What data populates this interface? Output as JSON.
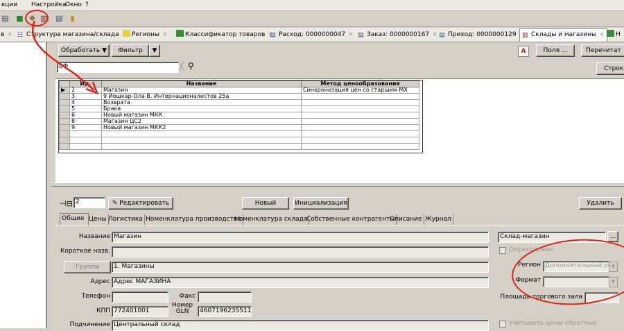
{
  "menu": {
    "items": [
      "кции",
      "Настройка",
      "Окно",
      "?"
    ]
  },
  "doc_tabs": [
    {
      "label": "в",
      "active": false
    },
    {
      "label": "Структура магазина/склада",
      "active": false
    },
    {
      "label": "Регионы",
      "active": false
    },
    {
      "label": "Классификатор товаров",
      "active": false
    },
    {
      "label": "Расход: 0000000047",
      "active": false
    },
    {
      "label": "Заказ: 0000000167",
      "active": false
    },
    {
      "label": "Приход: 0000000129",
      "active": false
    },
    {
      "label": "Склады и магазины",
      "active": true
    },
    {
      "label": "Н",
      "active": false
    }
  ],
  "toolbar_top": {
    "process_label": "Обработать",
    "filter_label": "Фильтр",
    "fields_label": "Поля ...",
    "recalc_label": "Перечитат",
    "rows_label": "Строк",
    "a_badge": "A"
  },
  "search": {
    "value": "оФ"
  },
  "grid": {
    "columns": [
      "Ид.",
      "Название",
      "Метод ценообразования"
    ],
    "rows": [
      {
        "id": "2",
        "name": "Магазин",
        "method": "Синхронизация цен со старшим МХ",
        "current": true
      },
      {
        "id": "3",
        "name": "9 Йошкар-Ола В. Интернационалистов 25а",
        "method": "",
        "current": false
      },
      {
        "id": "4",
        "name": "Возврата",
        "method": "",
        "current": false
      },
      {
        "id": "5",
        "name": "Брака",
        "method": "",
        "current": false
      },
      {
        "id": "6",
        "name": "Новый магазин МКК",
        "method": "",
        "current": false
      },
      {
        "id": "8",
        "name": "Магазин ЦС2",
        "method": "",
        "current": false
      },
      {
        "id": "9",
        "name": "Новый магазин МКК2",
        "method": "",
        "current": false
      }
    ]
  },
  "detail_toolbar": {
    "id_value": "2",
    "edit_label": "Редактировать",
    "new_label": "Новый",
    "init_label": "Инициализация",
    "delete_label": "Удалить"
  },
  "detail_tabs": [
    "Общие",
    "Цены",
    "Логистика",
    "Номенклатура производства",
    "Номенклатура склада",
    "Собственные контрагенты",
    "Описание",
    "Журнал"
  ],
  "form": {
    "name_label": "Название",
    "name_value": "Магазин",
    "short_label": "Короткое назв.",
    "short_value": "",
    "group_button": "Группа",
    "group_value": "1. Магазины",
    "address_label": "Адрес",
    "address_value": "Адрес МАГАЗИНА",
    "phone_label": "Телефон",
    "phone_value": "",
    "fax_label": "Факс",
    "fax_value": "",
    "kpp_label": "КПП",
    "kpp_value": "772401001",
    "gln_label_1": "Номер",
    "gln_label_2": "GLN",
    "gln_value": "4607196235511",
    "subordination_label": "Подчинение",
    "subordination_value": "Центральный склад",
    "type_value": "Склад-магазин",
    "type_button": "...",
    "posted_label": "Оприходован",
    "region_label": "Регион",
    "region_value": "Дополнительный регі",
    "format_label": "Формат",
    "format_value": "",
    "area_label": "Площадь торгового зала",
    "area_value": "",
    "reverse_prices_label": "Учитывать цены обратных"
  },
  "colors": {
    "annotation": "#e0231a",
    "window_bg": "#d4d0c8"
  }
}
